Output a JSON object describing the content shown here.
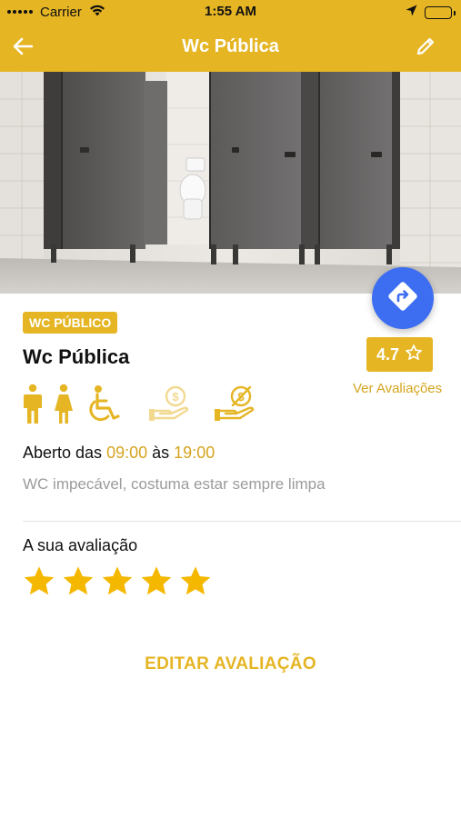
{
  "status_bar": {
    "carrier": "Carrier",
    "time": "1:55 AM"
  },
  "nav": {
    "title": "Wc Pública",
    "back_icon": "arrow-left-icon",
    "edit_icon": "pencil-icon"
  },
  "place": {
    "category_badge": "WC PÚBLICO",
    "name": "Wc Pública",
    "rating": "4.7",
    "see_reviews": "Ver Avaliações",
    "amenities": [
      "male-icon",
      "female-icon",
      "wheelchair-accessible-icon",
      "paid-icon",
      "free-icon"
    ],
    "hours_prefix": "Aberto das",
    "open_time": "09:00",
    "hours_mid": "às",
    "close_time": "19:00",
    "description": "WC impecável, costuma estar sempre limpa"
  },
  "your_rating": {
    "label": "A sua avaliação",
    "stars": 5,
    "max_stars": 5
  },
  "actions": {
    "edit_review": "EDITAR AVALIAÇÃO"
  },
  "colors": {
    "accent": "#E5B524",
    "fab": "#3D6EF2",
    "muted_text": "#9b9b9b"
  }
}
